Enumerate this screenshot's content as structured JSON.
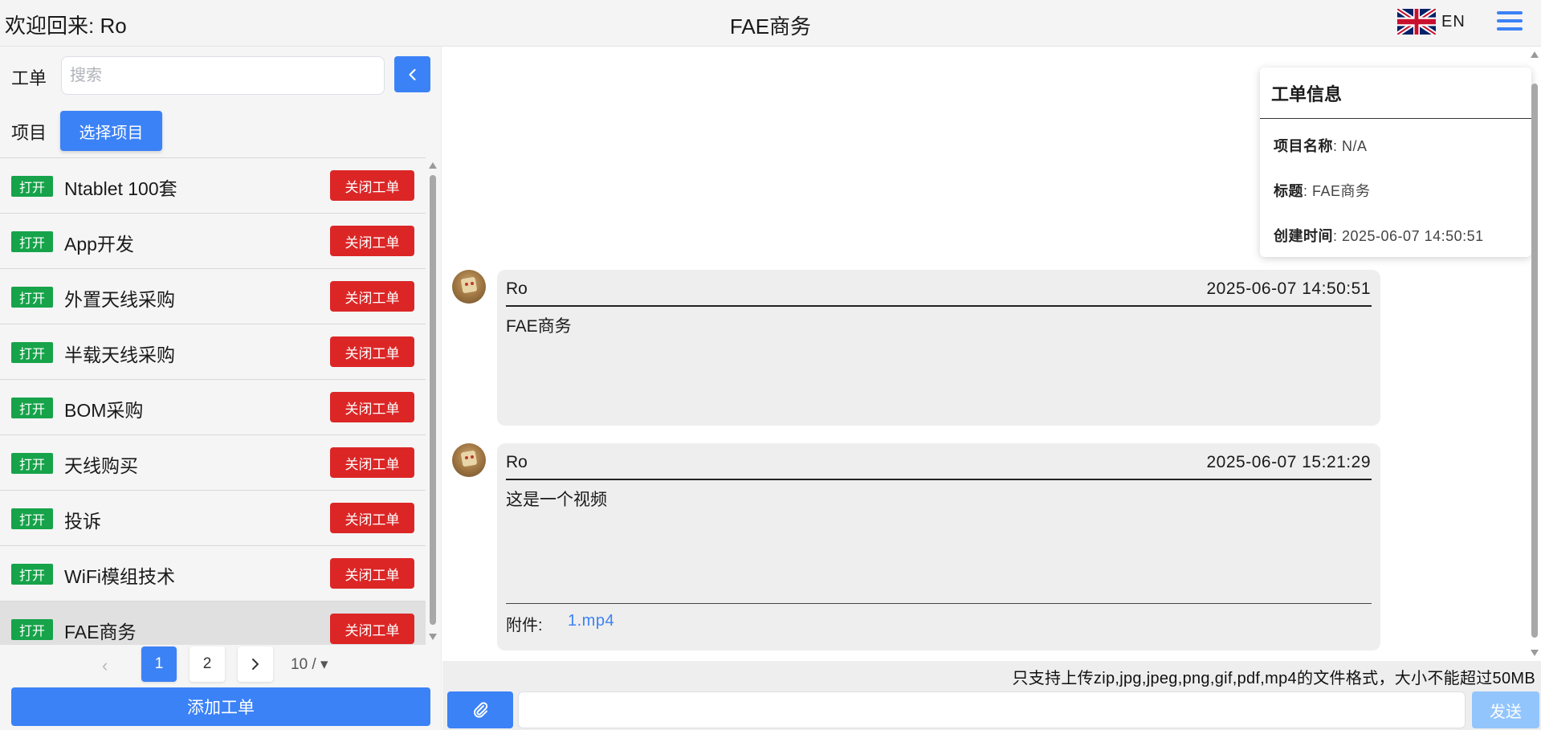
{
  "header": {
    "welcome": "欢迎回来: Ro",
    "title": "FAE商务",
    "lang": "EN",
    "flag_icon": "uk-flag-icon",
    "menu_icon": "hamburger-menu-icon",
    "accent_color": "#3b82f6"
  },
  "sidebar": {
    "ticket_label": "工单",
    "search_placeholder": "搜索",
    "search_value": "",
    "project_label": "项目",
    "select_project_label": "选择项目",
    "items": [
      {
        "status": "打开",
        "title": "Ntablet 100套",
        "close_label": "关闭工单"
      },
      {
        "status": "打开",
        "title": "App开发",
        "close_label": "关闭工单"
      },
      {
        "status": "打开",
        "title": "外置天线采购",
        "close_label": "关闭工单"
      },
      {
        "status": "打开",
        "title": "半载天线采购",
        "close_label": "关闭工单"
      },
      {
        "status": "打开",
        "title": "BOM采购",
        "close_label": "关闭工单"
      },
      {
        "status": "打开",
        "title": "天线购买",
        "close_label": "关闭工单"
      },
      {
        "status": "打开",
        "title": "投诉",
        "close_label": "关闭工单"
      },
      {
        "status": "打开",
        "title": "WiFi模组技术",
        "close_label": "关闭工单"
      },
      {
        "status": "打开",
        "title": "FAE商务",
        "close_label": "关闭工单"
      }
    ],
    "pager": {
      "prev": "‹",
      "pages": [
        "1",
        "2"
      ],
      "current": "1",
      "page_size": "10 / ▾"
    },
    "add_ticket_label": "添加工单"
  },
  "info": {
    "title": "工单信息",
    "project_name_label": "项目名称",
    "project_name_value": ": N/A",
    "subject_label": "标题",
    "subject_value": ": FAE商务",
    "created_label": "创建时间",
    "created_value": ": 2025-06-07 14:50:51"
  },
  "messages": [
    {
      "user": "Ro",
      "time": "2025-06-07 14:50:51",
      "body": "FAE商务"
    },
    {
      "user": "Ro",
      "time": "2025-06-07 15:21:29",
      "body": "这是一个视频",
      "attachment_label": "附件:",
      "attachment_file": "1.mp4"
    }
  ],
  "composer": {
    "hint": "只支持上传zip,jpg,jpeg,png,gif,pdf,mp4的文件格式，大小不能超过50MB",
    "input_value": "",
    "send_label": "发送",
    "attach_icon": "paperclip-icon"
  }
}
